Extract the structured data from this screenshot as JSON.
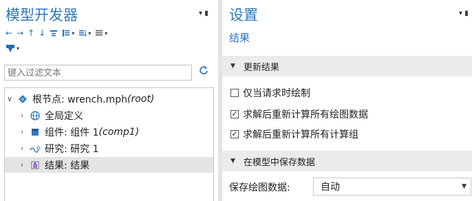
{
  "left_panel": {
    "title": "模型开发器",
    "filter_placeholder": "键入过滤文本",
    "tree": [
      {
        "label": "根节点: wrench.mph ",
        "suffix": "(root)",
        "expanded": true
      },
      {
        "label": "全局定义",
        "suffix": ""
      },
      {
        "label": "组件: 组件 1 ",
        "suffix": "(comp1)"
      },
      {
        "label": "研究: 研究 1",
        "suffix": ""
      },
      {
        "label": "结果: 结果",
        "suffix": "",
        "selected": true
      }
    ]
  },
  "right_panel": {
    "title": "设置",
    "subtitle": "结果",
    "section1": "更新结果",
    "checks": [
      {
        "label": "仅当请求时绘制",
        "checked": false
      },
      {
        "label": "求解后重新计算所有绘图数据",
        "checked": true
      },
      {
        "label": "求解后重新计算所有计算组",
        "checked": true
      }
    ],
    "section2": "在模型中保存数据",
    "save_plot_label": "保存绘图数据:",
    "save_plot_value": "自动"
  },
  "colors": {
    "accent": "#2f79bd",
    "section_bg": "#ebebeb",
    "selected_bg": "#e4e4e4"
  }
}
